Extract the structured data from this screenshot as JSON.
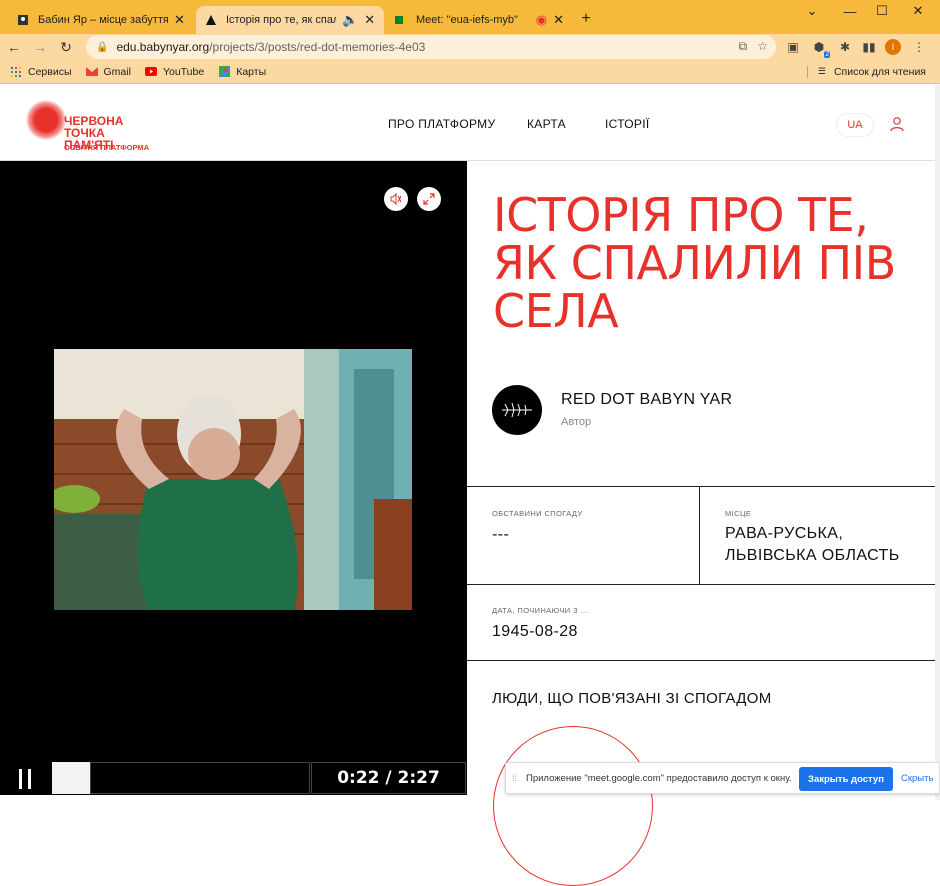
{
  "browser": {
    "tabs": [
      {
        "title": "Бабин Яр – місце забуття і місця пам'яті",
        "icon": "page-icon",
        "active": false
      },
      {
        "title": "Історія про те, як спалили пів села",
        "icon": "triangle-icon",
        "active": true
      },
      {
        "title": "Meet: \"eua-iefs-myb\"",
        "icon": "meet-icon",
        "active": false
      }
    ],
    "url_host": "edu.babynyar.org",
    "url_path": "/projects/3/posts/red-dot-memories-4e03",
    "profile_initial": "I",
    "extension_badge": "2",
    "bookmarks": [
      {
        "label": "Сервисы",
        "icon": "apps-grid-icon"
      },
      {
        "label": "Gmail",
        "icon": "gmail-icon"
      },
      {
        "label": "YouTube",
        "icon": "youtube-icon"
      },
      {
        "label": "Карты",
        "icon": "maps-icon"
      }
    ],
    "reading_list": "Список для чтения",
    "colors": {
      "frame": "#f6b93b",
      "toolbar": "#fbd9a0"
    }
  },
  "site": {
    "logo_line1": "ЧЕРВОНА ТОЧКА",
    "logo_line2": "ПАМ'ЯТІ",
    "logo_sub": "ОСВІТНЯ ПЛАТФОРМА",
    "nav": [
      "ПРО ПЛАТФОРМУ",
      "КАРТА",
      "ІСТОРІЇ"
    ],
    "lang": "UA",
    "accent": "#e8312b"
  },
  "video": {
    "time": "0:22 / 2:27",
    "progress": 0.15
  },
  "story": {
    "title": "ІСТОРІЯ ПРО ТЕ, ЯК СПАЛИЛИ ПІВ СЕЛА",
    "author_name": "RED DOT BABYN YAR",
    "author_role": "Автор",
    "circumstances_label": "ОБСТАВИНИ СПОГАДУ",
    "circumstances_value": "---",
    "place_label": "МІСЦЕ",
    "place_value": "РАВА-РУСЬКА, ЛЬВІВСЬКА ОБЛАСТЬ",
    "date_label": "ДАТА, ПОЧИНАЮЧИ З ...",
    "date_value": "1945-08-28",
    "people_heading": "ЛЮДИ, ЩО ПОВ'ЯЗАНІ ЗІ СПОГАДОМ"
  },
  "infobar": {
    "message": "Приложение \"meet.google.com\" предоставило доступ к окну.",
    "stop_label": "Закрыть доступ",
    "hide_label": "Скрыть"
  }
}
